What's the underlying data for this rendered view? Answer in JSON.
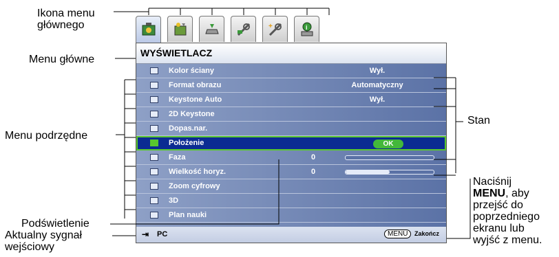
{
  "callouts": {
    "main_icon_line1": "Ikona menu",
    "main_icon_line2": "głównego",
    "main_menu": "Menu główne",
    "submenu": "Menu podrzędne",
    "highlight": "Podświetlenie",
    "input_line1": "Aktualny sygnał",
    "input_line2": "wejściowy",
    "status": "Stan",
    "press_line1": "Naciśnij",
    "press_menu": "MENU",
    "press_line2_rest": ", aby",
    "press_line3": "przejść do",
    "press_line4": "poprzedniego",
    "press_line5": "ekranu lub",
    "press_line6": "wyjść z menu."
  },
  "tabs": [
    {
      "name": "display-tab-icon",
      "active": true
    },
    {
      "name": "picture-tab-icon",
      "active": false
    },
    {
      "name": "source-tab-icon",
      "active": false
    },
    {
      "name": "system-setup-basic-tab-icon",
      "active": false
    },
    {
      "name": "system-setup-advanced-tab-icon",
      "active": false
    },
    {
      "name": "information-tab-icon",
      "active": false
    }
  ],
  "menu": {
    "title": "WYŚWIETLACZ",
    "items": [
      {
        "label": "Kolor ściany",
        "value": "Wył."
      },
      {
        "label": "Format obrazu",
        "value": "Automatyczny"
      },
      {
        "label": "Keystone Auto",
        "value": "Wył."
      },
      {
        "label": "2D Keystone",
        "value": ""
      },
      {
        "label": "Dopas.nar.",
        "value": ""
      },
      {
        "label": "Położenie",
        "value": "OK"
      },
      {
        "label": "Faza",
        "value": "0",
        "level": 0
      },
      {
        "label": "Wielkość horyz.",
        "value": "0",
        "level": 0.5
      },
      {
        "label": "Zoom cyfrowy",
        "value": ""
      },
      {
        "label": "3D",
        "value": ""
      },
      {
        "label": "Plan nauki",
        "value": ""
      }
    ]
  },
  "footer": {
    "source": "PC",
    "menu_button": "MENU",
    "exit": "Zakończ"
  },
  "colors": {
    "highlight_border": "#59c72f",
    "ok_button": "#43b83a",
    "menu_bg": "#5b72a6"
  }
}
